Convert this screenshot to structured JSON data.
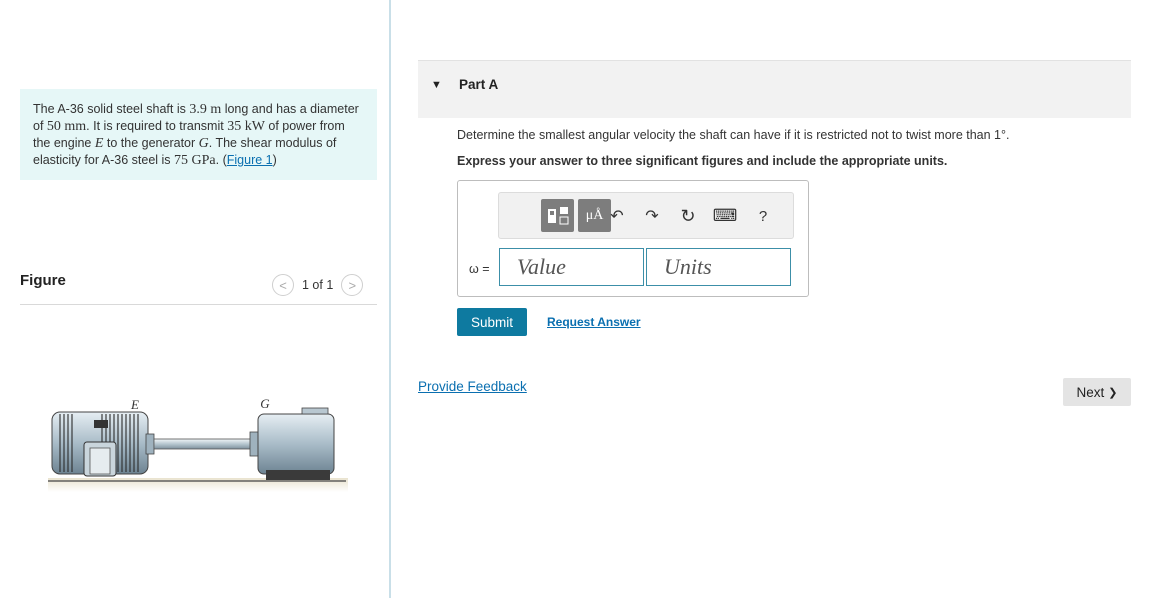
{
  "problem": {
    "t1": "The A-36 solid steel shaft is ",
    "length_val": "3.9",
    "length_unit": "m",
    "t2": " long and has a diameter of ",
    "diam_val": "50",
    "diam_unit": "mm",
    "t3": ". It is required to transmit ",
    "power_val": "35",
    "power_unit": "kW",
    "t4": " of power from the engine ",
    "engine": "E",
    "t5": " to the generator ",
    "generator": "G",
    "t6": ". The shear modulus of elasticity for A-36 steel is ",
    "g_val": "75",
    "g_unit": "GPa",
    "t7": ". (",
    "figure_link": "Figure 1",
    "t8": ")"
  },
  "figure_panel": {
    "label": "Figure",
    "prev_icon": "<",
    "pager": "1 of 1",
    "next_icon": ">",
    "label_e": "E",
    "label_g": "G"
  },
  "part": {
    "caret": "▼",
    "title": "Part A"
  },
  "question": "Determine the smallest angular velocity the shaft can have if it is restricted not to twist more than 1°.",
  "instruction": "Express your answer to three significant figures and include the appropriate units.",
  "toolbar": {
    "units_btn": "μÅ",
    "undo": "↶",
    "redo": "↷",
    "reset": "↻",
    "keyboard": "⌨",
    "help": "?"
  },
  "answer": {
    "label": "ω =",
    "value_placeholder": "Value",
    "units_placeholder": "Units"
  },
  "actions": {
    "submit": "Submit",
    "request_answer": "Request Answer",
    "provide_feedback": "Provide Feedback",
    "next": "Next",
    "next_icon": "❯"
  },
  "colors": {
    "accent": "#0e7aa0",
    "link": "#0a6fb0",
    "problem_bg": "#e6f7f7"
  }
}
